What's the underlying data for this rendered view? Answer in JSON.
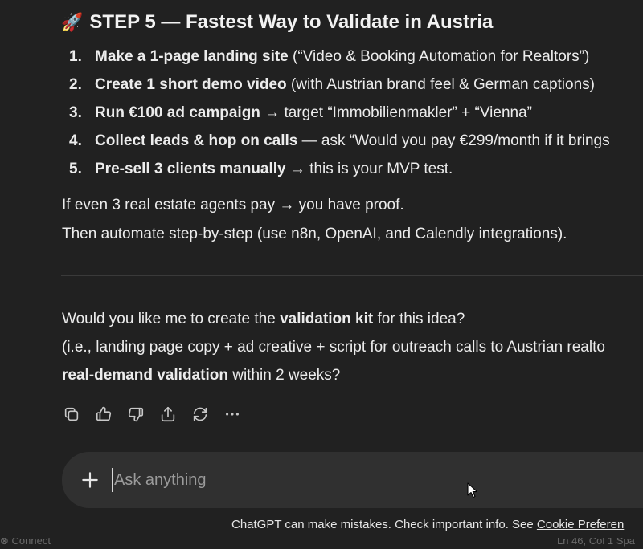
{
  "message": {
    "heading": {
      "emoji": "🚀",
      "text": "STEP 5 — Fastest Way to Validate in Austria"
    },
    "steps": [
      {
        "num": "1.",
        "bold": "Make a 1-page landing site",
        "rest": " (“Video & Booking Automation for Realtors”)"
      },
      {
        "num": "2.",
        "bold": "Create 1 short demo video",
        "rest": " (with Austrian brand feel & German captions)"
      },
      {
        "num": "3.",
        "bold": "Run €100 ad campaign",
        "rest": " → target “Immobilienmakler” + “Vienna”"
      },
      {
        "num": "4.",
        "bold": "Collect leads & hop on calls",
        "rest": " — ask “Would you pay €299/month if it brings"
      },
      {
        "num": "5.",
        "bold": "Pre-sell 3 clients manually",
        "rest": " → this is your MVP test."
      }
    ],
    "proof_line": "If even 3 real estate agents pay → you have proof.",
    "automate_line": "Then automate step-by-step (use n8n, OpenAI, and Calendly integrations).",
    "followup": {
      "pre": "Would you like me to create the ",
      "bold": "validation kit",
      "post": " for this idea?",
      "line2": "(i.e., landing page copy + ad creative + script for outreach calls to Austrian realto",
      "line3_bold": "real-demand validation",
      "line3_rest": " within 2 weeks?"
    }
  },
  "actions": [
    "copy-icon",
    "thumbs-up-icon",
    "thumbs-down-icon",
    "share-icon",
    "regenerate-icon",
    "more-icon"
  ],
  "composer": {
    "placeholder": "Ask anything"
  },
  "footer": {
    "disclaimer": "ChatGPT can make mistakes. Check important info. See ",
    "link": "Cookie Preferen"
  },
  "statusbar": {
    "left": "⊗ Connect",
    "right": "Ln 46, Col 1   Spa"
  }
}
